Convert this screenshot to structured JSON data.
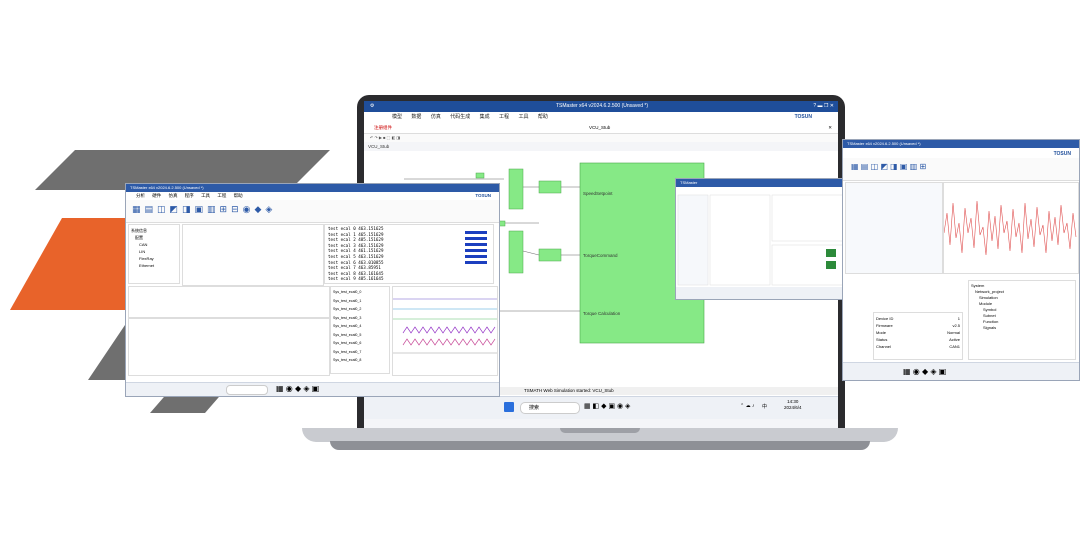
{
  "main_window": {
    "title": "TSMaster x64 v2024.6.2.500 (Unsaved *)",
    "menu": [
      "模型",
      "数据",
      "仿真",
      "代码生成",
      "集成",
      "工程",
      "工具",
      "帮助"
    ],
    "brand": "TOSUN",
    "tab_label": "VCU_Stub",
    "breadcrumb": "VCU_Stub",
    "warning_label": "注册组件",
    "status_bar": "TSMATH Web Simulation started: VCU_Stub",
    "blocks": [
      "SpeedSetpoint",
      "TorqueCommand",
      "Torque Calculation"
    ]
  },
  "left_window": {
    "title": "TSMaster x64 v2024.6.2.500 (Unsaved *)",
    "brand": "TOSUN",
    "menu": [
      "分析",
      "硬件",
      "仿真",
      "程序",
      "工具",
      "工程",
      "帮助"
    ],
    "trace_lines": [
      "test ecal 0  463.151625",
      "test ecal 1  465.151629",
      "test ecal 2  485.151629",
      "test ecal 3  463.151629",
      "test ecal 4  461.151629",
      "test ecal 5  463.151629",
      "test ecal 6  463.010855",
      "test ecal 7  463.85951",
      "test ecal 8  463.161645",
      "test ecal 9  485.161645"
    ],
    "signal_names": [
      "Sys_test_ecal0_0",
      "Sys_test_ecal0_1",
      "Sys_test_ecal0_2",
      "Sys_test_ecal0_3",
      "Sys_test_ecal0_4",
      "Sys_test_ecal0_5",
      "Sys_test_ecal0_6",
      "Sys_test_ecal0_7",
      "Sys_test_ecal0_8"
    ],
    "tree": [
      "系统信息",
      "配置",
      "CAN",
      "LIN",
      "FlexRay",
      "Ethernet"
    ]
  },
  "right_window": {
    "title": "TSMaster x64 v2024.6.2.500 (Unsaved *)",
    "brand": "TOSUN",
    "tree": [
      "System",
      "Network_project",
      "Simulation",
      "Module",
      "Symbol",
      "Subnet",
      "Function",
      "Signals"
    ],
    "props": [
      [
        "Device ID",
        "1"
      ],
      [
        "Firmware",
        "v2.5"
      ],
      [
        "Mode",
        "Normal"
      ],
      [
        "Status",
        "Active"
      ],
      [
        "Channel",
        "CAN1"
      ]
    ]
  },
  "mid_window": {
    "title": "TSMaster"
  },
  "taskbar": {
    "search_label": "搜索",
    "time": "14:30",
    "date": "2024/6/4",
    "ime": "中"
  },
  "colors": {
    "accent": "#1f4e9a",
    "orange": "#e8632a",
    "gray": "#6f6f6f",
    "block_green": "#86e986"
  }
}
